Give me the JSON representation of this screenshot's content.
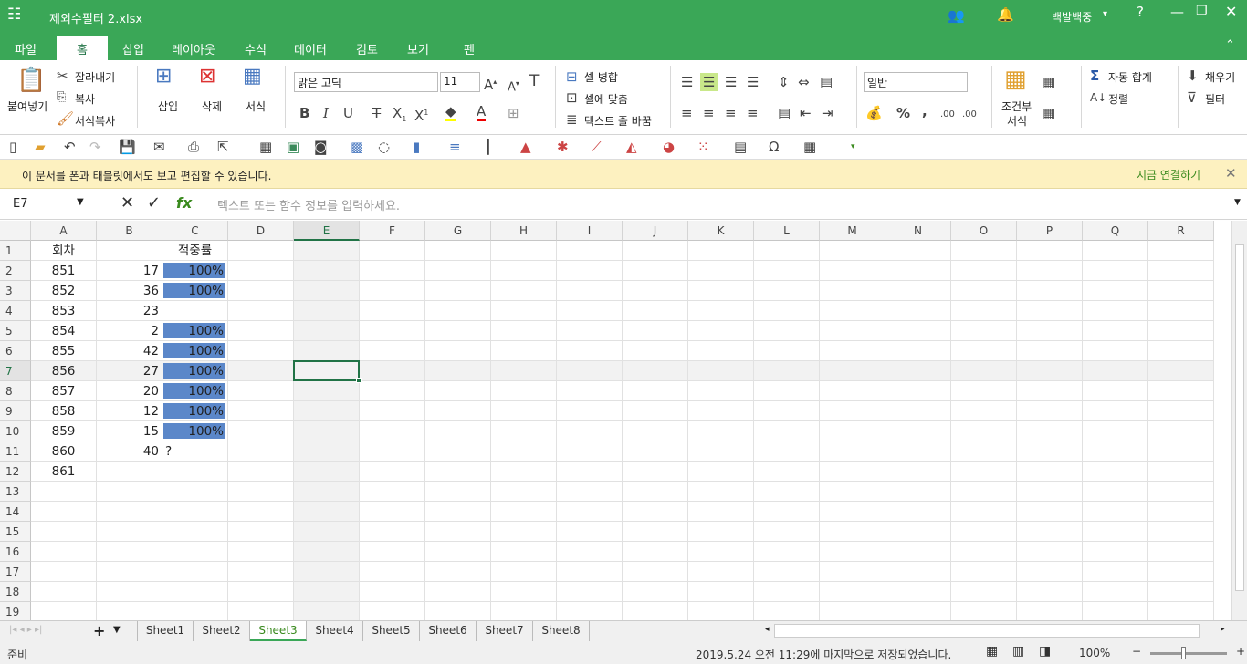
{
  "title": "제외수필터 2.xlsx",
  "user": "백발백중",
  "tabs": [
    "파일",
    "홈",
    "삽입",
    "레이아웃",
    "수식",
    "데이터",
    "검토",
    "보기",
    "펜"
  ],
  "ribbon": {
    "paste": "붙여넣기",
    "cut": "잘라내기",
    "copy": "복사",
    "format_painter": "서식복사",
    "insert": "삽입",
    "delete": "삭제",
    "format": "서식",
    "font": "맑은 고딕",
    "size": "11",
    "merge": "셀 병합",
    "fit": "셀에 맞춤",
    "wrap": "텍스트 줄 바꿈",
    "number_format": "일반",
    "cond_format_1": "조건부",
    "cond_format_2": "서식",
    "autosum": "자동 합계",
    "sort": "정렬",
    "fill": "채우기",
    "filter": "필터"
  },
  "notice": {
    "text": "이 문서를 폰과 태블릿에서도 보고 편집할 수 있습니다.",
    "link": "지금 연결하기"
  },
  "formula_bar": {
    "name_box": "E7",
    "fx": "fx",
    "placeholder": "텍스트 또는 함수 정보를 입력하세요."
  },
  "columns": [
    "A",
    "B",
    "C",
    "D",
    "E",
    "F",
    "G",
    "H",
    "I",
    "J",
    "K",
    "L",
    "M",
    "N",
    "O",
    "P",
    "Q",
    "R"
  ],
  "selected_cell": "E7",
  "rows": [
    [
      "회차",
      "",
      "적중률"
    ],
    [
      "851",
      "17",
      "100%"
    ],
    [
      "852",
      "36",
      "100%"
    ],
    [
      "853",
      "23",
      ""
    ],
    [
      "854",
      "2",
      "100%"
    ],
    [
      "855",
      "42",
      "100%"
    ],
    [
      "856",
      "27",
      "100%"
    ],
    [
      "857",
      "20",
      "100%"
    ],
    [
      "858",
      "12",
      "100%"
    ],
    [
      "859",
      "15",
      "100%"
    ],
    [
      "860",
      "40",
      "?"
    ],
    [
      "861",
      "",
      ""
    ],
    [
      "",
      "",
      ""
    ],
    [
      "",
      "",
      ""
    ],
    [
      "",
      "",
      ""
    ],
    [
      "",
      "",
      ""
    ],
    [
      "",
      "",
      ""
    ],
    [
      "",
      "",
      ""
    ],
    [
      "",
      "",
      ""
    ]
  ],
  "sheets": [
    "Sheet1",
    "Sheet2",
    "Sheet3",
    "Sheet4",
    "Sheet5",
    "Sheet6",
    "Sheet7",
    "Sheet8"
  ],
  "active_sheet": "Sheet3",
  "status": {
    "ready": "준비",
    "saved": "2019.5.24 오전 11:29에 마지막으로 저장되었습니다.",
    "zoom": "100%"
  },
  "colors": {
    "accent": "#3aa757",
    "bar": "#5b87c9"
  }
}
